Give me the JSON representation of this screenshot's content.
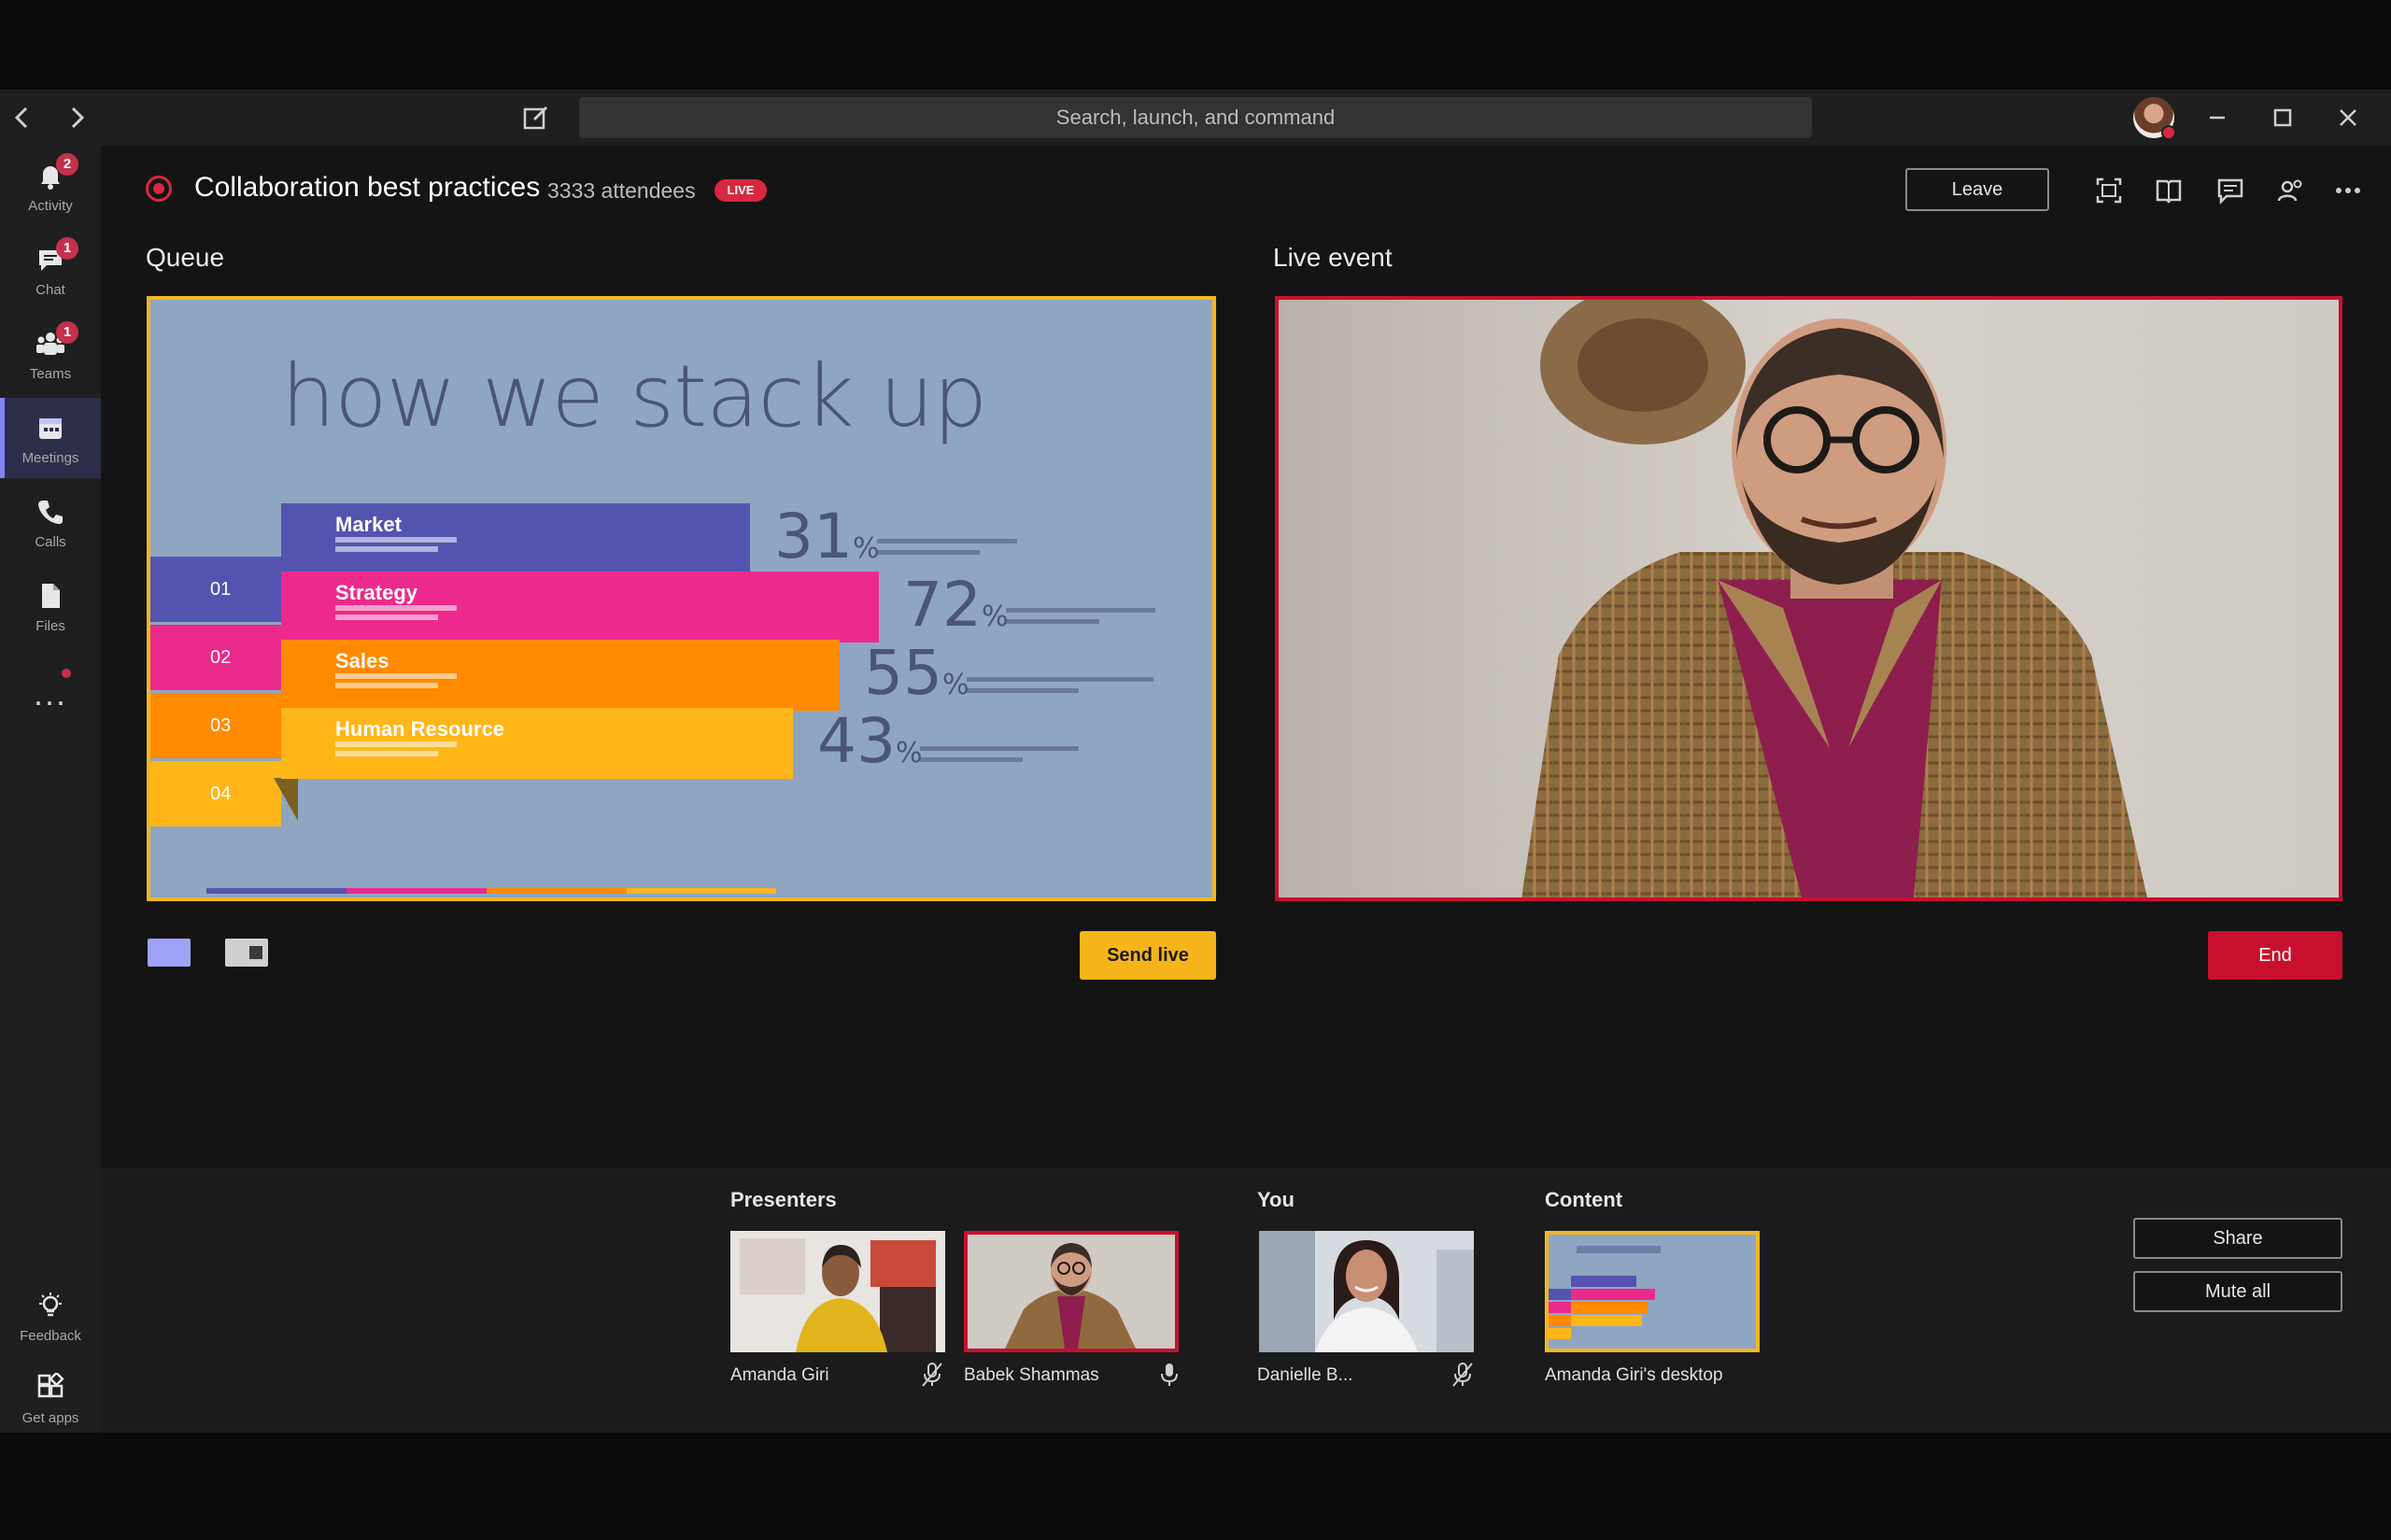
{
  "titlebar": {
    "search_placeholder": "Search, launch, and command",
    "back_icon": "chevron-left-icon",
    "forward_icon": "chevron-right-icon",
    "compose_icon": "compose-icon",
    "window_controls": [
      "minimize-icon",
      "maximize-icon",
      "close-icon"
    ]
  },
  "rail": {
    "items": [
      {
        "label": "Activity",
        "icon": "bell-icon",
        "badge": "2"
      },
      {
        "label": "Chat",
        "icon": "chat-icon",
        "badge": "1"
      },
      {
        "label": "Teams",
        "icon": "teams-icon",
        "badge": "1"
      },
      {
        "label": "Meetings",
        "icon": "calendar-icon",
        "badge": ""
      },
      {
        "label": "Calls",
        "icon": "phone-icon",
        "badge": ""
      },
      {
        "label": "Files",
        "icon": "file-icon",
        "badge": ""
      }
    ],
    "more": "...",
    "bottom_items": [
      {
        "label": "Feedback",
        "icon": "lightbulb-icon"
      },
      {
        "label": "Get apps",
        "icon": "apps-icon"
      }
    ],
    "active": "Meetings"
  },
  "event": {
    "title": "Collaboration best practices",
    "attendees": "3333 attendees",
    "live_badge": "LIVE",
    "leave_label": "Leave"
  },
  "queue": {
    "label": "Queue",
    "slide": {
      "title": "how we stack up",
      "rows": [
        {
          "num": "01",
          "name": "Market",
          "pct": "31",
          "color": "#5454b0"
        },
        {
          "num": "02",
          "name": "Strategy",
          "pct": "72",
          "color": "#ec2a8c"
        },
        {
          "num": "03",
          "name": "Sales",
          "pct": "55",
          "color": "#ff8a00"
        },
        {
          "num": "04",
          "name": "Human Resource",
          "pct": "43",
          "color": "#ffb619"
        }
      ],
      "pct_unit": "%"
    },
    "send_live_label": "Send live"
  },
  "live": {
    "label": "Live event",
    "end_label": "End"
  },
  "bottom": {
    "presenters_label": "Presenters",
    "you_label": "You",
    "content_label": "Content",
    "presenters": [
      {
        "name": "Amanda Giri",
        "mic": "mic-off-icon"
      },
      {
        "name": "Babek Shammas",
        "mic": "mic-icon"
      }
    ],
    "you": {
      "name": "Danielle B...",
      "mic": "mic-off-icon"
    },
    "content": {
      "name": "Amanda Giri's desktop"
    },
    "share_label": "Share",
    "mute_all_label": "Mute all"
  },
  "colors": {
    "accent": "#7f85f5",
    "live_red": "#c8102e",
    "queue_yellow": "#f2b721"
  }
}
